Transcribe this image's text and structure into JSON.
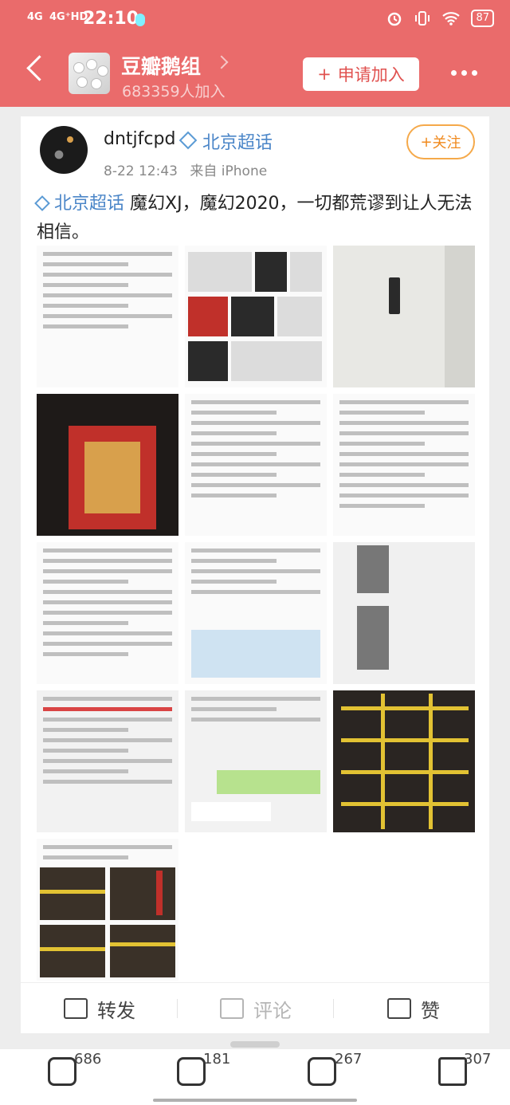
{
  "status_bar": {
    "net1": "4G",
    "net2": "4G⁺HD",
    "time": "22:10",
    "battery": "87"
  },
  "group": {
    "name": "豆瓣鹅组",
    "member_count": "683359人加入",
    "join_button": "申请加入"
  },
  "post": {
    "author": "dntjfcpd",
    "topic_tag": "北京超话",
    "time": "8-22 12:43",
    "source": "来自 iPhone",
    "follow_button": "关注",
    "hashtag": "北京超话",
    "text": " 魔幻XJ，魔幻2020，一切都荒谬到让人无法相信。"
  },
  "actions": {
    "repost": "转发",
    "comment": "评论",
    "like": "赞"
  },
  "bottom_bar": {
    "comments": "686",
    "likes": "181",
    "reposts": "267",
    "favorites": "307"
  },
  "colors": {
    "accent": "#ea6b6b",
    "link": "#4b86c8",
    "follow": "#f08a1e"
  },
  "images": [
    {
      "icon": "comment-screenshot"
    },
    {
      "icon": "door-photo-collage"
    },
    {
      "icon": "door-lock-photo"
    },
    {
      "icon": "red-door-photo"
    },
    {
      "icon": "comment-screenshot"
    },
    {
      "icon": "text-screenshot"
    },
    {
      "icon": "text-screenshot"
    },
    {
      "icon": "map-screenshot"
    },
    {
      "icon": "street-photo"
    },
    {
      "icon": "chat-screenshot"
    },
    {
      "icon": "chat-screenshot"
    },
    {
      "icon": "sealed-doors-photo"
    },
    {
      "icon": "sealed-doors-collage"
    }
  ]
}
